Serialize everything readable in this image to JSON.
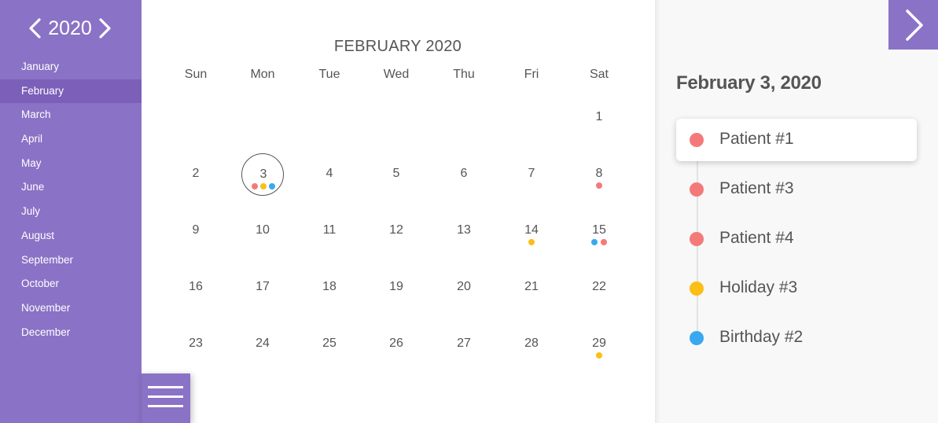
{
  "sidebar": {
    "year": "2020",
    "months": [
      "January",
      "February",
      "March",
      "April",
      "May",
      "June",
      "July",
      "August",
      "September",
      "October",
      "November",
      "December"
    ],
    "active_month_index": 1
  },
  "calendar": {
    "title": "FEBRUARY 2020",
    "weekdays": [
      "Sun",
      "Mon",
      "Tue",
      "Wed",
      "Thu",
      "Fri",
      "Sat"
    ],
    "weeks": [
      [
        null,
        null,
        null,
        null,
        null,
        null,
        "1"
      ],
      [
        "2",
        "3",
        "4",
        "5",
        "6",
        "7",
        "8"
      ],
      [
        "9",
        "10",
        "11",
        "12",
        "13",
        "14",
        "15"
      ],
      [
        "16",
        "17",
        "18",
        "19",
        "20",
        "21",
        "22"
      ],
      [
        "23",
        "24",
        "25",
        "26",
        "27",
        "28",
        "29"
      ]
    ],
    "selected_day": "3",
    "day_events": {
      "3": [
        "patient",
        "holiday",
        "birthday"
      ],
      "8": [
        "patient"
      ],
      "14": [
        "holiday"
      ],
      "15": [
        "birthday",
        "patient"
      ],
      "29": [
        "holiday"
      ]
    }
  },
  "colors": {
    "accent": "#8a72c6",
    "accent_active": "#7b5fb9",
    "patient": "#f47a7a",
    "holiday": "#fbbf16",
    "birthday": "#3aa8f0"
  },
  "panel": {
    "date": "February 3, 2020",
    "events": [
      {
        "label": "Patient #1",
        "type": "patient",
        "active": true
      },
      {
        "label": "Patient #3",
        "type": "patient",
        "active": false
      },
      {
        "label": "Patient #4",
        "type": "patient",
        "active": false
      },
      {
        "label": "Holiday #3",
        "type": "holiday",
        "active": false
      },
      {
        "label": "Birthday #2",
        "type": "birthday",
        "active": false
      }
    ]
  },
  "icons": {
    "prev_year": "chevron-left-icon",
    "next_year": "chevron-right-icon",
    "menu": "hamburger-icon",
    "next_panel": "chevron-right-icon"
  }
}
